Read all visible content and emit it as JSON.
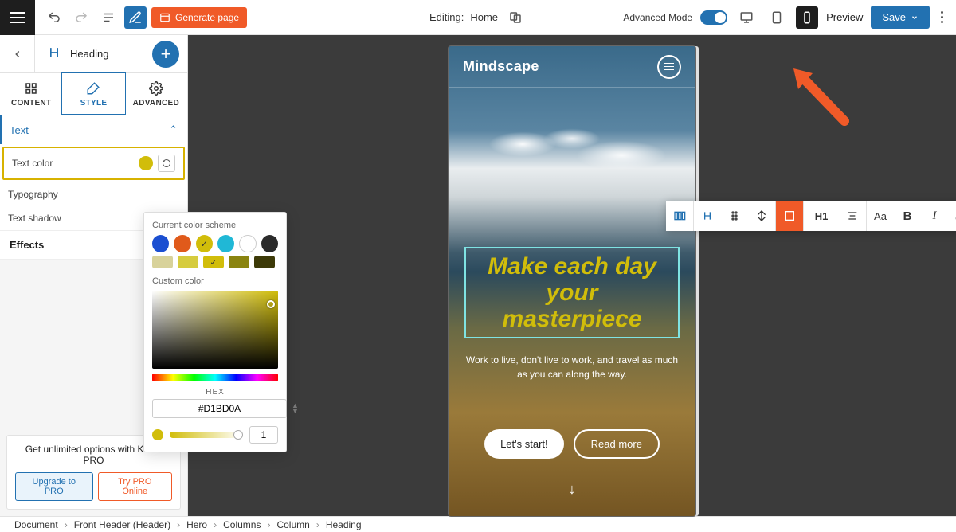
{
  "topbar": {
    "generate_label": "Generate page",
    "editing_prefix": "Editing:",
    "editing_page": "Home",
    "advanced_label": "Advanced Mode",
    "preview_label": "Preview",
    "save_label": "Save"
  },
  "sidebar": {
    "block_name": "Heading",
    "tabs": {
      "content": "CONTENT",
      "style": "STYLE",
      "advanced": "ADVANCED"
    },
    "sections": {
      "text": "Text",
      "text_color": "Text color",
      "typography": "Typography",
      "text_shadow": "Text shadow",
      "effects": "Effects"
    },
    "text_color_value": "#D1BD0A"
  },
  "color_popover": {
    "scheme_label": "Current color scheme",
    "custom_label": "Custom color",
    "hex_label": "HEX",
    "hex_value": "#D1BD0A",
    "opacity_value": "1",
    "scheme_colors": [
      "#1b4fd1",
      "#e05a1b",
      "#d1bd0a",
      "#20b8d6",
      "#ffffff",
      "#2b2b2b"
    ],
    "scheme_tints": [
      "#d8d29a",
      "#d6cc3e",
      "#d1bd0a",
      "#8a8410",
      "#3d3a08"
    ],
    "selected_index_row1": 2,
    "selected_index_row2": 2
  },
  "promo": {
    "text": "Get unlimited options with Kubio PRO",
    "upgrade": "Upgrade to PRO",
    "try": "Try PRO Online"
  },
  "canvas": {
    "brand": "Mindscape",
    "headline": "Make each day your masterpiece",
    "subhead": "Work to live, don't live to work, and travel as much as you can along the way.",
    "cta_primary": "Let's start!",
    "cta_secondary": "Read more"
  },
  "floating_toolbar": {
    "heading_level": "H1",
    "text_size_label": "Aa",
    "bold_label": "B",
    "italic_label": "I"
  },
  "breadcrumbs": [
    "Document",
    "Front Header (Header)",
    "Hero",
    "Columns",
    "Column",
    "Heading"
  ]
}
